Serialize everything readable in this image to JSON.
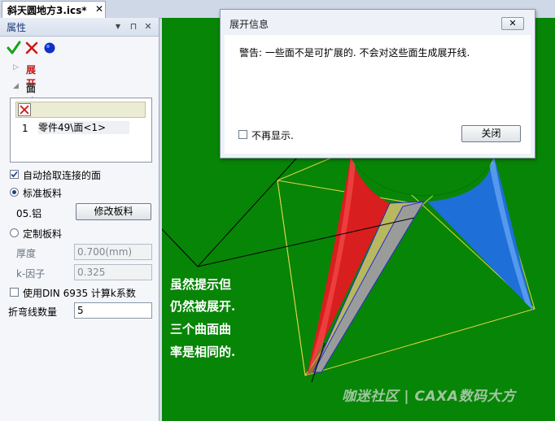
{
  "doc_tab": {
    "title": "斜天圆地方3.ics*",
    "close_glyph": "✕"
  },
  "panel": {
    "title": "属性",
    "header_buttons": {
      "dropdown": "▼",
      "pin": "⊓",
      "close": "✕"
    },
    "sections": {
      "unfold": "展开",
      "face_select": "面选择"
    },
    "face_list": {
      "index": "1",
      "name": "零件49\\面<1>"
    },
    "auto_pick_label": "自动拾取连接的面",
    "standard_sheet_label": "标准板料",
    "material": "05.铝",
    "modify_button": "修改板料",
    "custom_sheet_label": "定制板料",
    "thickness_label": "厚度",
    "thickness_value": "0.700(mm)",
    "k_factor_label": "k-因子",
    "k_factor_value": "0.325",
    "din_label": "使用DIN 6935 计算k系数",
    "bend_count_label": "折弯线数量",
    "bend_count_value": "5"
  },
  "dialog": {
    "title": "展开信息",
    "close_glyph": "✕",
    "message": "警告: 一些面不是可扩展的. 不会对这些面生成展开线.",
    "dont_show_label": "不再显示.",
    "ok_button": "关闭"
  },
  "annotation": {
    "line1": "虽然提示但",
    "line2": "仍然被展开.",
    "line3": "三个曲面曲",
    "line4": "率是相同的."
  },
  "watermark": "咖迷社区 | CAXA数码大方",
  "colors": {
    "viewport_bg": "#078507",
    "red_surface": "#d81e1e",
    "blue_surface": "#1e6fd8",
    "wireframe": "#e2d24a",
    "accent_title": "#1a3a7a"
  }
}
